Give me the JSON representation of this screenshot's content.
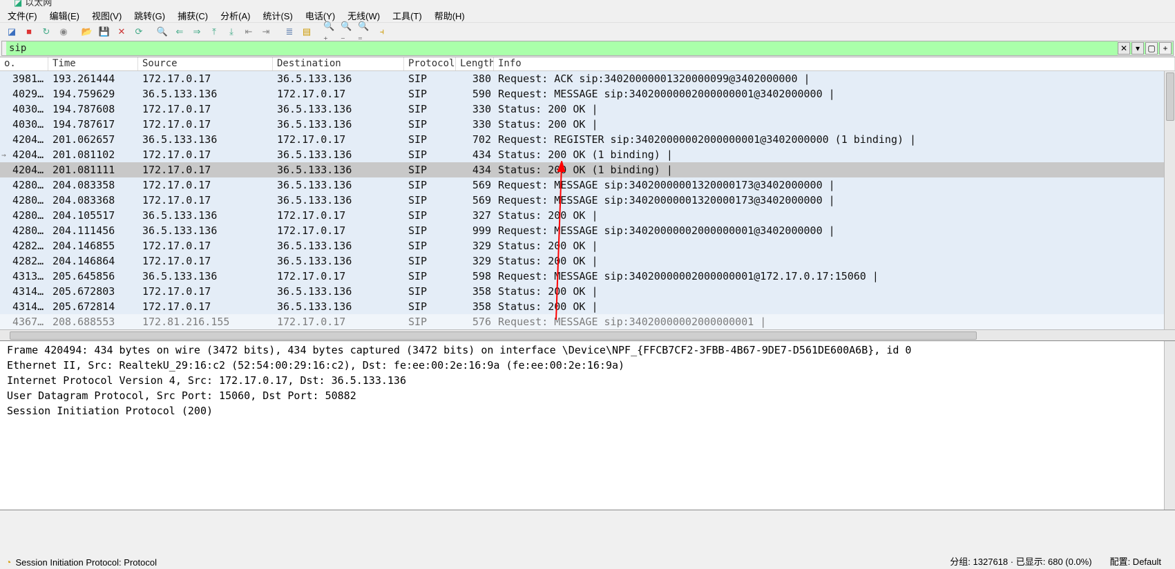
{
  "title": "以太网",
  "menu": [
    "文件(F)",
    "编辑(E)",
    "视图(V)",
    "跳转(G)",
    "捕获(C)",
    "分析(A)",
    "统计(S)",
    "电话(Y)",
    "无线(W)",
    "工具(T)",
    "帮助(H)"
  ],
  "toolbar_icons": [
    {
      "name": "fin-icon",
      "glyph": "◪",
      "color": "#3a6fbf"
    },
    {
      "name": "stop-icon",
      "glyph": "■",
      "color": "#d33"
    },
    {
      "name": "restart-icon",
      "glyph": "↻",
      "color": "#4a8"
    },
    {
      "name": "options-icon",
      "glyph": "◉",
      "color": "#888"
    },
    {
      "name": "sep"
    },
    {
      "name": "open-icon",
      "glyph": "📂",
      "color": "#c90"
    },
    {
      "name": "save-icon",
      "glyph": "💾",
      "color": "#57a"
    },
    {
      "name": "close-icon",
      "glyph": "✕",
      "color": "#c33"
    },
    {
      "name": "reload-icon",
      "glyph": "⟳",
      "color": "#4a8"
    },
    {
      "name": "sep"
    },
    {
      "name": "find-icon",
      "glyph": "🔍",
      "color": "#555"
    },
    {
      "name": "prev-icon",
      "glyph": "⇐",
      "color": "#4a8"
    },
    {
      "name": "next-icon",
      "glyph": "⇒",
      "color": "#4a8"
    },
    {
      "name": "jump-prev-icon",
      "glyph": "⤒",
      "color": "#4a8"
    },
    {
      "name": "jump-next-icon",
      "glyph": "⤓",
      "color": "#4a8"
    },
    {
      "name": "first-icon",
      "glyph": "⇤",
      "color": "#888"
    },
    {
      "name": "last-icon",
      "glyph": "⇥",
      "color": "#888"
    },
    {
      "name": "sep"
    },
    {
      "name": "autoscroll-icon",
      "glyph": "≣",
      "color": "#57a"
    },
    {
      "name": "colorize-icon",
      "glyph": "▤",
      "color": "#c90"
    },
    {
      "name": "sep"
    },
    {
      "name": "zoom-in-icon",
      "glyph": "🔍₊",
      "color": "#555"
    },
    {
      "name": "zoom-out-icon",
      "glyph": "🔍₋",
      "color": "#555"
    },
    {
      "name": "zoom-reset-icon",
      "glyph": "🔍₌",
      "color": "#555"
    },
    {
      "name": "resize-cols-icon",
      "glyph": "⫞",
      "color": "#c90"
    }
  ],
  "filter": {
    "value": "sip",
    "clear": "✕",
    "arrow": "▾",
    "plus": "+"
  },
  "columns": {
    "no": "o.",
    "time": "Time",
    "src": "Source",
    "dst": "Destination",
    "proto": "Protocol",
    "len": "Length",
    "info": "Info"
  },
  "rows": [
    {
      "no": "3981…",
      "time": "193.261444",
      "src": "172.17.0.17",
      "dst": "36.5.133.136",
      "proto": "SIP",
      "len": "380",
      "info": "Request: ACK sip:34020000001320000099@3402000000  | "
    },
    {
      "no": "4029…",
      "time": "194.759629",
      "src": "36.5.133.136",
      "dst": "172.17.0.17",
      "proto": "SIP",
      "len": "590",
      "info": "Request: MESSAGE sip:34020000002000000001@3402000000  | "
    },
    {
      "no": "4030…",
      "time": "194.787608",
      "src": "172.17.0.17",
      "dst": "36.5.133.136",
      "proto": "SIP",
      "len": "330",
      "info": "Status: 200 OK  | "
    },
    {
      "no": "4030…",
      "time": "194.787617",
      "src": "172.17.0.17",
      "dst": "36.5.133.136",
      "proto": "SIP",
      "len": "330",
      "info": "Status: 200 OK  | "
    },
    {
      "no": "4204…",
      "time": "201.062657",
      "src": "36.5.133.136",
      "dst": "172.17.0.17",
      "proto": "SIP",
      "len": "702",
      "info": "Request: REGISTER sip:34020000002000000001@3402000000  (1 binding)  | "
    },
    {
      "no": "4204…",
      "time": "201.081102",
      "src": "172.17.0.17",
      "dst": "36.5.133.136",
      "proto": "SIP",
      "len": "434",
      "info": "Status: 200 OK  (1 binding)  | ",
      "marker": "→"
    },
    {
      "no": "4204…",
      "time": "201.081111",
      "src": "172.17.0.17",
      "dst": "36.5.133.136",
      "proto": "SIP",
      "len": "434",
      "info": "Status: 200 OK  (1 binding)  | ",
      "selected": true
    },
    {
      "no": "4280…",
      "time": "204.083358",
      "src": "172.17.0.17",
      "dst": "36.5.133.136",
      "proto": "SIP",
      "len": "569",
      "info": "Request: MESSAGE sip:34020000001320000173@3402000000  | "
    },
    {
      "no": "4280…",
      "time": "204.083368",
      "src": "172.17.0.17",
      "dst": "36.5.133.136",
      "proto": "SIP",
      "len": "569",
      "info": "Request: MESSAGE sip:34020000001320000173@3402000000  | "
    },
    {
      "no": "4280…",
      "time": "204.105517",
      "src": "36.5.133.136",
      "dst": "172.17.0.17",
      "proto": "SIP",
      "len": "327",
      "info": "Status: 200 OK  | "
    },
    {
      "no": "4280…",
      "time": "204.111456",
      "src": "36.5.133.136",
      "dst": "172.17.0.17",
      "proto": "SIP",
      "len": "999",
      "info": "Request: MESSAGE sip:34020000002000000001@3402000000  | "
    },
    {
      "no": "4282…",
      "time": "204.146855",
      "src": "172.17.0.17",
      "dst": "36.5.133.136",
      "proto": "SIP",
      "len": "329",
      "info": "Status: 200 OK  | "
    },
    {
      "no": "4282…",
      "time": "204.146864",
      "src": "172.17.0.17",
      "dst": "36.5.133.136",
      "proto": "SIP",
      "len": "329",
      "info": "Status: 200 OK  | "
    },
    {
      "no": "4313…",
      "time": "205.645856",
      "src": "36.5.133.136",
      "dst": "172.17.0.17",
      "proto": "SIP",
      "len": "598",
      "info": "Request: MESSAGE sip:34020000002000000001@172.17.0.17:15060  | "
    },
    {
      "no": "4314…",
      "time": "205.672803",
      "src": "172.17.0.17",
      "dst": "36.5.133.136",
      "proto": "SIP",
      "len": "358",
      "info": "Status: 200 OK  | "
    },
    {
      "no": "4314…",
      "time": "205.672814",
      "src": "172.17.0.17",
      "dst": "36.5.133.136",
      "proto": "SIP",
      "len": "358",
      "info": "Status: 200 OK  | "
    },
    {
      "no": "4367…",
      "time": "208.688553",
      "src": "172.81.216.155",
      "dst": "172.17.0.17",
      "proto": "SIP",
      "len": "576",
      "info": "Request: MESSAGE sip:34020000002000000001  | ",
      "partial": true
    }
  ],
  "details": [
    "Frame 420494: 434 bytes on wire (3472 bits), 434 bytes captured (3472 bits) on interface \\Device\\NPF_{FFCB7CF2-3FBB-4B67-9DE7-D561DE600A6B}, id 0",
    "Ethernet II, Src: RealtekU_29:16:c2 (52:54:00:29:16:c2), Dst: fe:ee:00:2e:16:9a (fe:ee:00:2e:16:9a)",
    "Internet Protocol Version 4, Src: 172.17.0.17, Dst: 36.5.133.136",
    "User Datagram Protocol, Src Port: 15060, Dst Port: 50882",
    "Session Initiation Protocol (200)"
  ],
  "status": {
    "left_icon": "◔",
    "left_text": "Session Initiation Protocol: Protocol",
    "packets_label": "分组:",
    "packets_val": "1327618",
    "displayed_label": "· 已显示:",
    "displayed_val": "680 (0.0%)",
    "profile_label": "配置: Default"
  }
}
